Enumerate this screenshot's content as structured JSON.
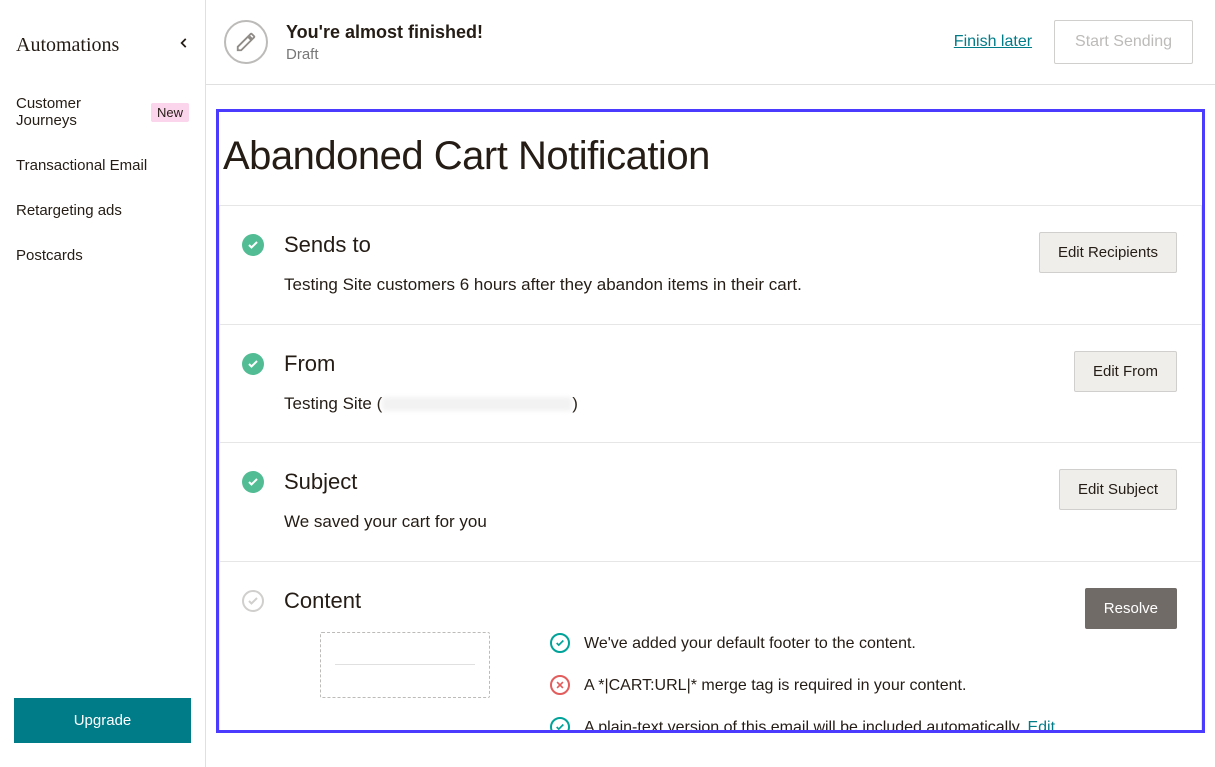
{
  "sidebar": {
    "title": "Automations",
    "items": [
      {
        "label": "Customer Journeys",
        "badge": "New"
      },
      {
        "label": "Transactional Email"
      },
      {
        "label": "Retargeting ads"
      },
      {
        "label": "Postcards"
      }
    ],
    "upgrade": "Upgrade"
  },
  "topbar": {
    "title": "You're almost finished!",
    "subtitle": "Draft",
    "finish_later": "Finish later",
    "start_sending": "Start Sending"
  },
  "page": {
    "title": "Abandoned Cart Notification"
  },
  "rows": {
    "sends_to": {
      "title": "Sends to",
      "desc": "Testing Site customers 6 hours after they abandon items in their cart.",
      "action": "Edit Recipients"
    },
    "from": {
      "title": "From",
      "desc_prefix": "Testing Site (",
      "desc_suffix": ")",
      "action": "Edit From"
    },
    "subject": {
      "title": "Subject",
      "desc": "We saved your cart for you",
      "action": "Edit Subject"
    },
    "content": {
      "title": "Content",
      "action": "Resolve",
      "messages": {
        "m0": "We've added your default footer to the content.",
        "m1": "A *|CART:URL|* merge tag is required in your content.",
        "m2_pre": "A plain-text version of this email will be included automatically. ",
        "m2_edit": "Edit"
      }
    }
  }
}
